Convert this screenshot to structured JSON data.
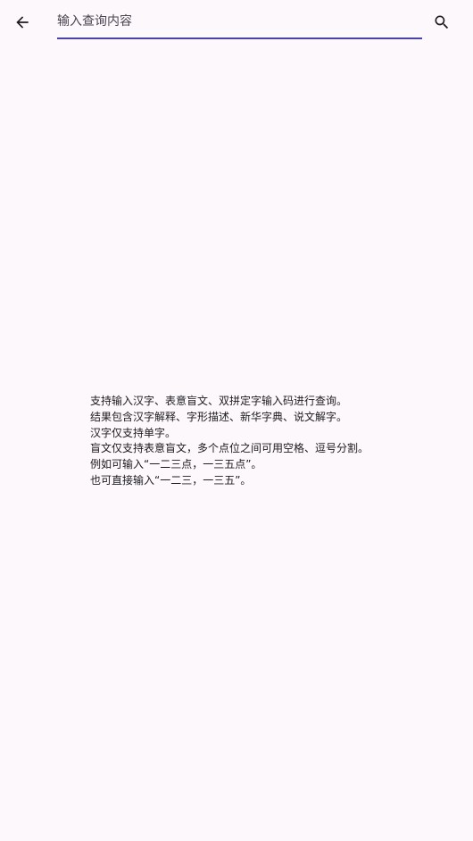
{
  "search": {
    "placeholder": "输入查询内容",
    "value": ""
  },
  "icons": {
    "back": "arrow-back-icon",
    "search": "search-icon"
  },
  "colors": {
    "background": "#fdf8fc",
    "accent": "#4a42a8",
    "text": "#1c1b1f"
  },
  "help": {
    "lines": [
      "支持输入汉字、表意盲文、双拼定字输入码进行查询。",
      "结果包含汉字解释、字形描述、新华字典、说文解字。",
      "汉字仅支持单字。",
      "盲文仅支持表意盲文，多个点位之间可用空格、逗号分割。",
      "例如可输入“一二三点，一三五点”。",
      "也可直接输入“一二三，一三五”。"
    ]
  }
}
